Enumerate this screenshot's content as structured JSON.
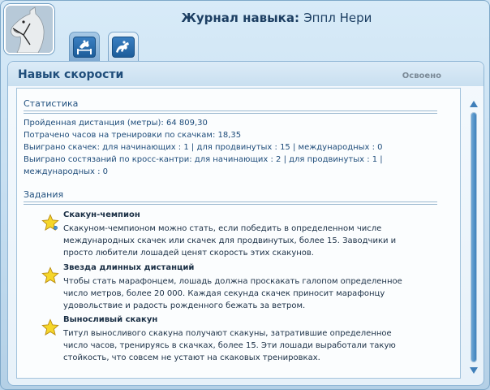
{
  "header": {
    "title_prefix": "Журнал навыка",
    "title_separator": ":",
    "title_name": "Эппл Нери"
  },
  "tabs": [
    {
      "icon": "jumping-horse-icon",
      "active": false
    },
    {
      "icon": "running-horse-icon",
      "active": true
    }
  ],
  "panel": {
    "title": "Навык скорости",
    "status": "Освоено"
  },
  "statistics": {
    "heading": "Статистика",
    "lines": [
      "Пройденная дистанция (метры): 64 809,30",
      "Потрачено часов на тренировки по скачкам: 18,35",
      "Выиграно скачек: для начинающих : 1 | для продвинутых : 15 | международных : 0",
      "Выиграно состязаний по кросс-кантри: для начинающих : 2 | для продвинутых : 1 |",
      "международных : 0"
    ]
  },
  "tasks": {
    "heading": "Задания",
    "items": [
      {
        "title": "Скакун-чемпион",
        "desc": [
          "Скакуном-чемпионом можно стать, если победить в определенном числе",
          "международных скачек или скачек для продвинутых, более 15. Заводчики и",
          "просто любители лошадей ценят скорость этих скакунов."
        ]
      },
      {
        "title": "Звезда длинных дистанций",
        "desc": [
          "Чтобы стать марафонцем, лошадь должна проскакать галопом определенное",
          "число метров, более 20 000. Каждая секунда скачек приносит марафонцу",
          "удовольствие и радость рожденного бежать за ветром."
        ]
      },
      {
        "title": "Выносливый скакун",
        "desc": [
          "Титул выносливого скакуна получают скакуны, затратившие определенное",
          "число часов, тренируясь в скачках, более 15. Эти лошади выработали такую",
          "стойкость, что совсем не устают на скаковых тренировках."
        ]
      }
    ]
  },
  "colors": {
    "accent": "#1f4d7a",
    "star_fill": "#f5d62a",
    "scroll_thumb": "#3f82bd"
  }
}
